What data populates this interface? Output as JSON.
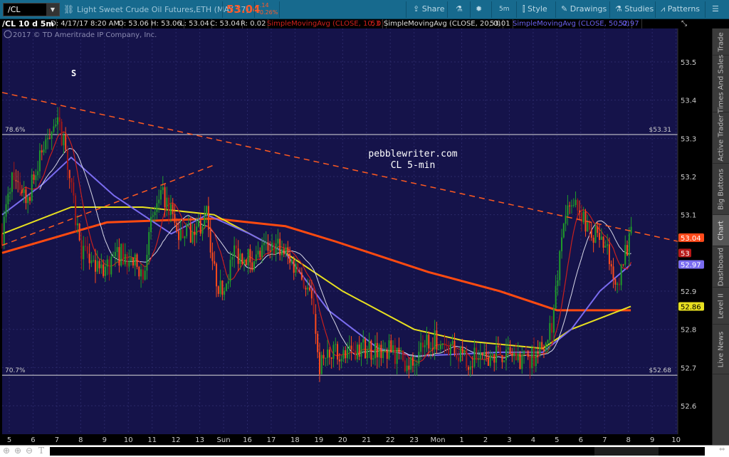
{
  "toolbar": {
    "symbol": "/CL",
    "title": "Light Sweet Crude Oil Futures,ETH (MAY 17)",
    "last": "53.04",
    "change": "-.14",
    "change_pct": "-0.26%",
    "share": "Share",
    "interval": "5m",
    "style": "Style",
    "drawings": "Drawings",
    "studies": "Studies",
    "patterns": "Patterns"
  },
  "info": {
    "symbol": "/CL 10 d 5m",
    "date": "D: 4/17/17 8:20 AM",
    "open": "O: 53.06",
    "high": "H: 53.06",
    "low": "L: 53.04",
    "close": "C: 53.04",
    "range": "R: 0.02",
    "sma10": "SimpleMovingAvg (CLOSE, 10, 0)",
    "sma10_val": "53",
    "sma20": "SimpleMovingAvg (CLOSE, 20, 0)",
    "sma20_val": "53.01",
    "sma50": "SimpleMovingAvg (CLOSE, 50, 0)",
    "sma50_val": "52.97"
  },
  "copyright": "2017 © TD Ameritrade IP Company, Inc.",
  "annotations": {
    "s_mark": "S",
    "site": "pebblewriter.com",
    "subtitle": "CL 5-min",
    "fib_upper_label": "78.6%",
    "fib_upper_price": "$53.31",
    "fib_lower_label": "70.7%",
    "fib_lower_price": "$52.68"
  },
  "right_tabs": [
    "Trade",
    "Times And Sales",
    "Active Trader",
    "Big Buttons",
    "Chart",
    "Dashboard",
    "Level II",
    "Live News"
  ],
  "active_tab": "Chart",
  "colors": {
    "bg": "#15134a",
    "up": "#1f9b2a",
    "down": "#ff4a1a",
    "sma10": "#c8201e",
    "sma20": "#d8d8e8",
    "sma50": "#7a6cf0",
    "yellow": "#e8e020",
    "orange": "#ff4a10"
  },
  "chart_data": {
    "type": "candlestick",
    "ylim": [
      52.55,
      53.6
    ],
    "yticks": [
      "53.5",
      "53.4",
      "53.3",
      "53.2",
      "53.1",
      "52.9",
      "52.8",
      "52.7",
      "52.6"
    ],
    "xticks": [
      "5",
      "6",
      "7",
      "8",
      "9",
      "10",
      "11",
      "12",
      "13",
      "Sun",
      "16",
      "17",
      "18",
      "19",
      "20",
      "21",
      "22",
      "23",
      "Mon",
      "1",
      "2",
      "3",
      "4",
      "5",
      "6",
      "7",
      "8",
      "9",
      "10"
    ],
    "price_path": [
      [
        -0.3,
        53.05
      ],
      [
        0.1,
        53.2
      ],
      [
        0.8,
        53.15
      ],
      [
        1.3,
        53.25
      ],
      [
        1.85,
        53.35
      ],
      [
        2.3,
        53.3
      ],
      [
        2.75,
        53.1
      ],
      [
        3.05,
        53.0
      ],
      [
        3.8,
        52.95
      ],
      [
        4.7,
        53.0
      ],
      [
        5.6,
        52.95
      ],
      [
        6.05,
        53.1
      ],
      [
        6.5,
        53.15
      ],
      [
        7.1,
        53.05
      ],
      [
        7.7,
        53.05
      ],
      [
        8.3,
        53.1
      ],
      [
        8.6,
        52.95
      ],
      [
        8.9,
        52.9
      ],
      [
        9.5,
        53.0
      ],
      [
        10.4,
        52.98
      ],
      [
        11.0,
        53.03
      ],
      [
        11.6,
        53.0
      ],
      [
        12.2,
        52.95
      ],
      [
        12.8,
        52.85
      ],
      [
        13.0,
        52.7
      ],
      [
        13.4,
        52.72
      ],
      [
        14.0,
        52.75
      ],
      [
        15.2,
        52.75
      ],
      [
        16.1,
        52.74
      ],
      [
        17.0,
        52.7
      ],
      [
        17.6,
        52.78
      ],
      [
        18.2,
        52.77
      ],
      [
        19.1,
        52.72
      ],
      [
        20.6,
        52.74
      ],
      [
        21.8,
        52.72
      ],
      [
        22.4,
        52.75
      ],
      [
        22.8,
        52.82
      ],
      [
        23.3,
        53.1
      ],
      [
        23.9,
        53.12
      ],
      [
        24.5,
        53.05
      ],
      [
        25.1,
        53.0
      ],
      [
        25.5,
        52.88
      ],
      [
        25.8,
        53.0
      ],
      [
        26.1,
        53.04
      ]
    ],
    "yellow_ma": [
      [
        -0.3,
        53.05
      ],
      [
        2.6,
        53.12
      ],
      [
        5.6,
        53.12
      ],
      [
        8.6,
        53.1
      ],
      [
        11.6,
        53.0
      ],
      [
        14.0,
        52.9
      ],
      [
        17.0,
        52.8
      ],
      [
        19.1,
        52.77
      ],
      [
        22.4,
        52.75
      ],
      [
        23.6,
        52.8
      ],
      [
        26.1,
        52.86
      ]
    ],
    "orange_ma": [
      [
        -0.3,
        53.0
      ],
      [
        4.1,
        53.08
      ],
      [
        8.6,
        53.09
      ],
      [
        11.6,
        53.07
      ],
      [
        13.7,
        53.03
      ],
      [
        17.6,
        52.95
      ],
      [
        20.6,
        52.9
      ],
      [
        23.0,
        52.85
      ],
      [
        26.1,
        52.85
      ]
    ],
    "sma50": [
      [
        -0.3,
        53.1
      ],
      [
        1.4,
        53.18
      ],
      [
        2.6,
        53.25
      ],
      [
        4.4,
        53.15
      ],
      [
        6.8,
        53.05
      ],
      [
        8.3,
        53.1
      ],
      [
        10.1,
        53.05
      ],
      [
        11.6,
        53.0
      ],
      [
        13.4,
        52.85
      ],
      [
        15.5,
        52.75
      ],
      [
        17.0,
        52.73
      ],
      [
        20.6,
        52.74
      ],
      [
        22.4,
        52.74
      ],
      [
        23.6,
        52.8
      ],
      [
        24.8,
        52.9
      ],
      [
        26.1,
        52.97
      ]
    ],
    "trendlines": [
      {
        "from": [
          -0.3,
          53.42
        ],
        "to": [
          28.1,
          53.03
        ]
      },
      {
        "from": [
          -0.3,
          53.02
        ],
        "to": [
          8.6,
          53.23
        ]
      }
    ],
    "hlines": [
      53.31,
      52.68
    ],
    "price_tags": [
      {
        "value": "53.04",
        "color": "#ff4a1a",
        "tc": "#fff"
      },
      {
        "value": "53",
        "color": "#b81818",
        "tc": "#fff"
      },
      {
        "value": "52.97",
        "color": "#7a6cf0",
        "tc": "#fff"
      },
      {
        "value": "52.86",
        "color": "#e8e020",
        "tc": "#000"
      }
    ]
  }
}
